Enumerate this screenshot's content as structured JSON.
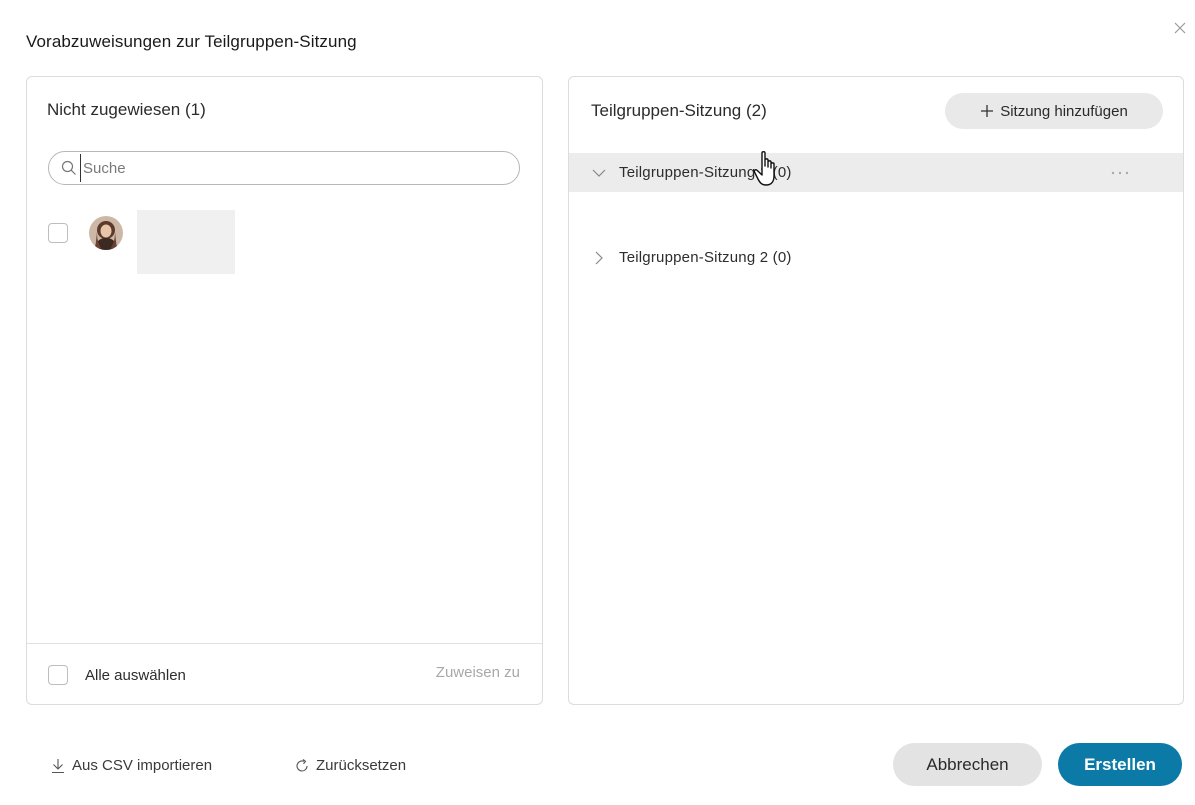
{
  "dialog": {
    "title": "Vorabzuweisungen zur Teilgruppen-Sitzung"
  },
  "unassigned": {
    "heading": "Nicht zugewiesen (1)",
    "search_placeholder": "Suche",
    "participants": [
      {
        "avatar": "avatar-photo",
        "name": ""
      }
    ],
    "select_all_label": "Alle auswählen",
    "assign_to_label": "Zuweisen zu"
  },
  "sessions": {
    "heading": "Teilgruppen-Sitzung (2)",
    "add_button_label": "Sitzung hinzufügen",
    "items": [
      {
        "label": "Teilgruppen-Sitzung 1 (0)",
        "expanded": true
      },
      {
        "label": "Teilgruppen-Sitzung 2 (0)",
        "expanded": false
      }
    ]
  },
  "footer": {
    "import_label": "Aus CSV importieren",
    "reset_label": "Zurücksetzen",
    "cancel_label": "Abbrechen",
    "create_label": "Erstellen"
  },
  "colors": {
    "primary": "#0c7aa6",
    "secondary_button": "#e3e3e3",
    "row_highlight": "#ececec"
  }
}
